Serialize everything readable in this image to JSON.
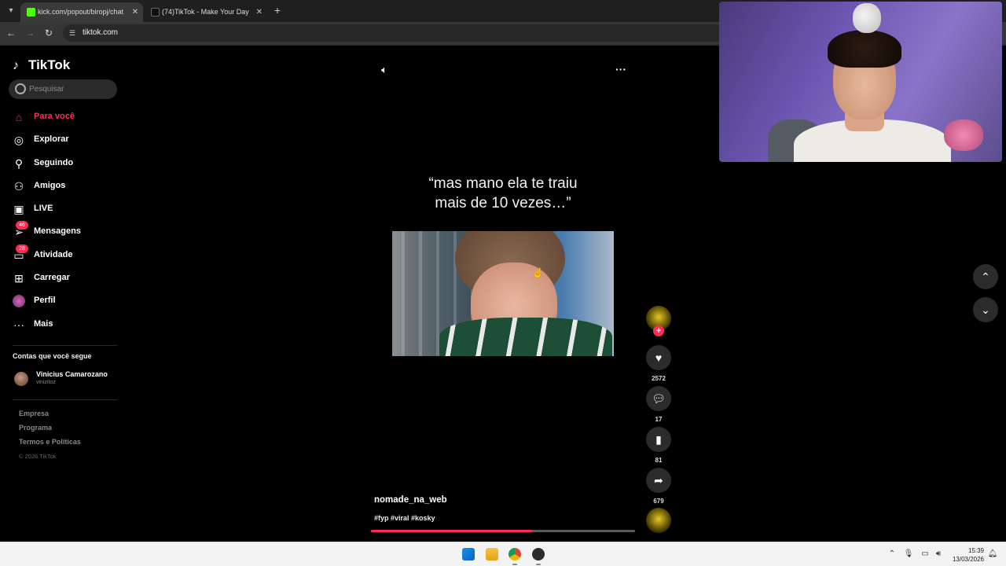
{
  "browser": {
    "tabs": [
      {
        "label": "kick.com/popout/biropj/chat",
        "favicon_color": "#53fc18",
        "active": true
      },
      {
        "label": "(74)TikTok - Make Your Day",
        "favicon_color": "#111111",
        "active": false
      }
    ],
    "address": "tiktok.com"
  },
  "sidebar": {
    "logo": "TikTok",
    "search_placeholder": "Pesquisar",
    "nav": [
      {
        "label": "Para você",
        "icon": "home-icon",
        "active": true
      },
      {
        "label": "Explorar",
        "icon": "compass-icon"
      },
      {
        "label": "Seguindo",
        "icon": "following-icon"
      },
      {
        "label": "Amigos",
        "icon": "friends-icon"
      },
      {
        "label": "LIVE",
        "icon": "live-icon"
      },
      {
        "label": "Mensagens",
        "icon": "messages-icon",
        "badge": "46"
      },
      {
        "label": "Atividade",
        "icon": "activity-icon",
        "badge": "28"
      },
      {
        "label": "Carregar",
        "icon": "upload-icon"
      },
      {
        "label": "Perfil",
        "icon": "profile-avatar"
      },
      {
        "label": "Mais",
        "icon": "more-icon"
      }
    ],
    "following_title": "Contas que você segue",
    "following": [
      {
        "name": "Vinicius Camarozano",
        "username": "vinizitoz"
      }
    ],
    "footer": [
      "Empresa",
      "Programa",
      "Termos e Políticas"
    ],
    "copyright": "© 2026 TikTok"
  },
  "video": {
    "caption_line1": "“mas mano ela te traiu",
    "caption_line2": "mais de 10 vezes…”",
    "author": "nomade_na_web",
    "hashtags": "#fyp #viral #kosky",
    "progress": 0.61,
    "accent": "#fe2c55",
    "counts": {
      "likes": "2572",
      "comments": "17",
      "saves": "81",
      "shares": "679"
    }
  },
  "taskbar": {
    "apps": [
      "windows-start-icon",
      "file-explorer-icon",
      "chrome-icon",
      "obs-icon"
    ],
    "time": "15:39",
    "date": "13/03/2026"
  }
}
